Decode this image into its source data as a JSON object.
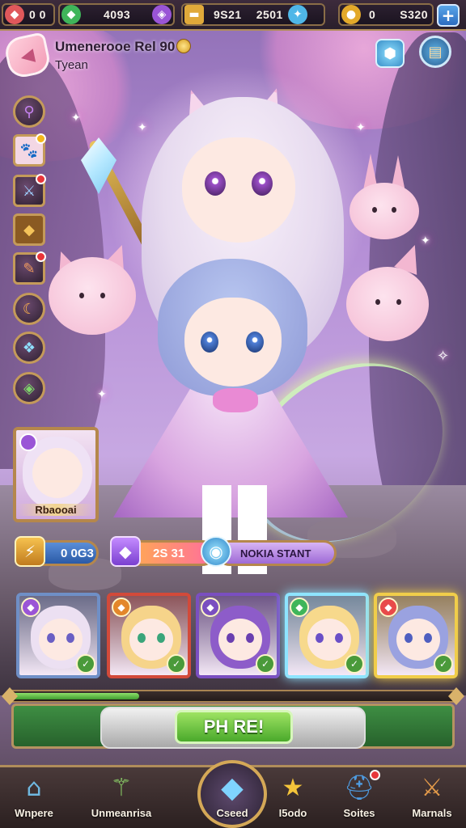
{
  "topbar": {
    "resources": [
      {
        "icon": "ruby-icon",
        "value": "0 0",
        "color": "#e0585b"
      },
      {
        "icon": "emerald-icon",
        "value": "4093",
        "color": "#3fb55a"
      },
      {
        "icon": "amethyst-icon",
        "value": "",
        "color": "#9a55d6"
      },
      {
        "icon": "gold-bar-icon",
        "value": "9S21",
        "color": "#e0a93a"
      },
      {
        "icon": "crystal-icon",
        "value": "2501",
        "color": "#4fb7e8"
      },
      {
        "icon": "coin-icon",
        "value": "0",
        "color": "#e3a92a"
      },
      {
        "icon": "gem-counter",
        "value": "S320",
        "color": "#5aa6e9"
      }
    ],
    "plus_label": "+"
  },
  "header": {
    "title": "Umenerooe Rel 90",
    "subtitle": "Tyean"
  },
  "side_menu": [
    {
      "name": "side-item-bow",
      "icon": "⚲"
    },
    {
      "name": "side-item-pet",
      "icon": "🐾",
      "badge": "yellow"
    },
    {
      "name": "side-item-sword",
      "icon": "⚔",
      "badge": "red"
    },
    {
      "name": "side-item-boot",
      "icon": "◆"
    },
    {
      "name": "side-item-brush",
      "icon": "✎",
      "badge": "red"
    },
    {
      "name": "side-item-moon",
      "icon": "☾"
    },
    {
      "name": "side-item-crystal",
      "icon": "❖"
    },
    {
      "name": "side-item-leaf",
      "icon": "◈"
    }
  ],
  "portrait": {
    "label": "Rbaooai"
  },
  "stats": {
    "power_value": "0 0G3",
    "gem_value": "2S 31",
    "quest_label": "NOKIA STANT"
  },
  "hero_cards": [
    {
      "frame": "#6f8fc6",
      "hair": "#ece0f2",
      "eye": "#6a5fc4"
    },
    {
      "frame": "#d24a3a",
      "hair": "#f6d48a",
      "eye": "#3aa57a"
    },
    {
      "frame": "#7a4fc0",
      "hair": "#8d5cc9",
      "eye": "#6a3fb0"
    },
    {
      "frame": "#8ee4ff",
      "hair": "#f7d98c",
      "eye": "#6a4fc7"
    },
    {
      "frame": "#f0cd4a",
      "hair": "#9aa2e0",
      "eye": "#4f5fc0"
    }
  ],
  "progress": {
    "fraction": 0.29
  },
  "main_button": {
    "label": "PH RE!"
  },
  "bottom_nav": [
    {
      "label": "Wnpere",
      "icon": "castle-icon"
    },
    {
      "label": "Unmeanrisa",
      "icon": "staff-icon"
    },
    {
      "label": "Cseed",
      "icon": "crystal-icon"
    },
    {
      "label": "I5odo",
      "icon": "star-icon"
    },
    {
      "label": "Soites",
      "icon": "helmet-icon"
    },
    {
      "label": "Marnals",
      "icon": "crossed-swords-icon"
    }
  ]
}
